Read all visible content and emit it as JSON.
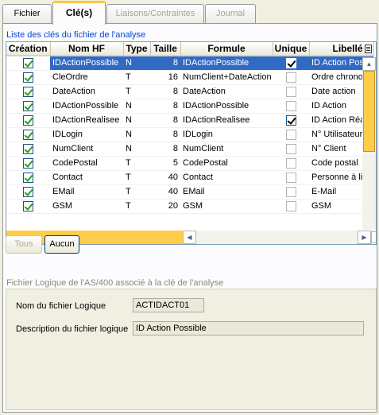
{
  "tabs": [
    {
      "label": "Fichier"
    },
    {
      "label": "Clé(s)"
    },
    {
      "label": "Liaisons/Contraintes"
    },
    {
      "label": "Journal"
    }
  ],
  "keys_list": {
    "caption": "Liste des clés du fichier de l'analyse",
    "columns": [
      "Création",
      "Nom HF",
      "Type",
      "Taille",
      "Formule",
      "Unique",
      "Libellé"
    ],
    "rows": [
      {
        "creation": true,
        "nom_hf": "IDActionPossible",
        "type": "N",
        "taille": "8",
        "formule": "IDActionPossible",
        "unique": true,
        "libelle": "ID Action Possible"
      },
      {
        "creation": true,
        "nom_hf": "CleOrdre",
        "type": "T",
        "taille": "16",
        "formule": "NumClient+DateAction",
        "unique": false,
        "libelle": "Ordre chronologique"
      },
      {
        "creation": true,
        "nom_hf": "DateAction",
        "type": "T",
        "taille": "8",
        "formule": "DateAction",
        "unique": false,
        "libelle": "Date action"
      },
      {
        "creation": true,
        "nom_hf": "IDActionPossible",
        "type": "N",
        "taille": "8",
        "formule": "IDActionPossible",
        "unique": false,
        "libelle": "ID Action"
      },
      {
        "creation": true,
        "nom_hf": "IDActionRealisee",
        "type": "N",
        "taille": "8",
        "formule": "IDActionRealisee",
        "unique": true,
        "libelle": "ID Action Réalisée"
      },
      {
        "creation": true,
        "nom_hf": "IDLogin",
        "type": "N",
        "taille": "8",
        "formule": "IDLogin",
        "unique": false,
        "libelle": "N° Utilisateur"
      },
      {
        "creation": true,
        "nom_hf": "NumClient",
        "type": "N",
        "taille": "8",
        "formule": "NumClient",
        "unique": false,
        "libelle": "N° Client"
      },
      {
        "creation": true,
        "nom_hf": "CodePostal",
        "type": "T",
        "taille": "5",
        "formule": "CodePostal",
        "unique": false,
        "libelle": "Code postal"
      },
      {
        "creation": true,
        "nom_hf": "Contact",
        "type": "T",
        "taille": "40",
        "formule": "Contact",
        "unique": false,
        "libelle": "Personne à livrer"
      },
      {
        "creation": true,
        "nom_hf": "EMail",
        "type": "T",
        "taille": "40",
        "formule": "EMail",
        "unique": false,
        "libelle": "E-Mail"
      },
      {
        "creation": true,
        "nom_hf": "GSM",
        "type": "T",
        "taille": "20",
        "formule": "GSM",
        "unique": false,
        "libelle": "GSM"
      }
    ]
  },
  "buttons": {
    "tous": "Tous",
    "aucun": "Aucun"
  },
  "logical_file": {
    "caption": "Fichier Logique de l'AS/400 associé à la clé de l'analyse",
    "name_label": "Nom du fichier Logique",
    "name_value": "ACTIDACT01",
    "desc_label": "Description du fichier logique",
    "desc_value": "ID Action Possible"
  }
}
